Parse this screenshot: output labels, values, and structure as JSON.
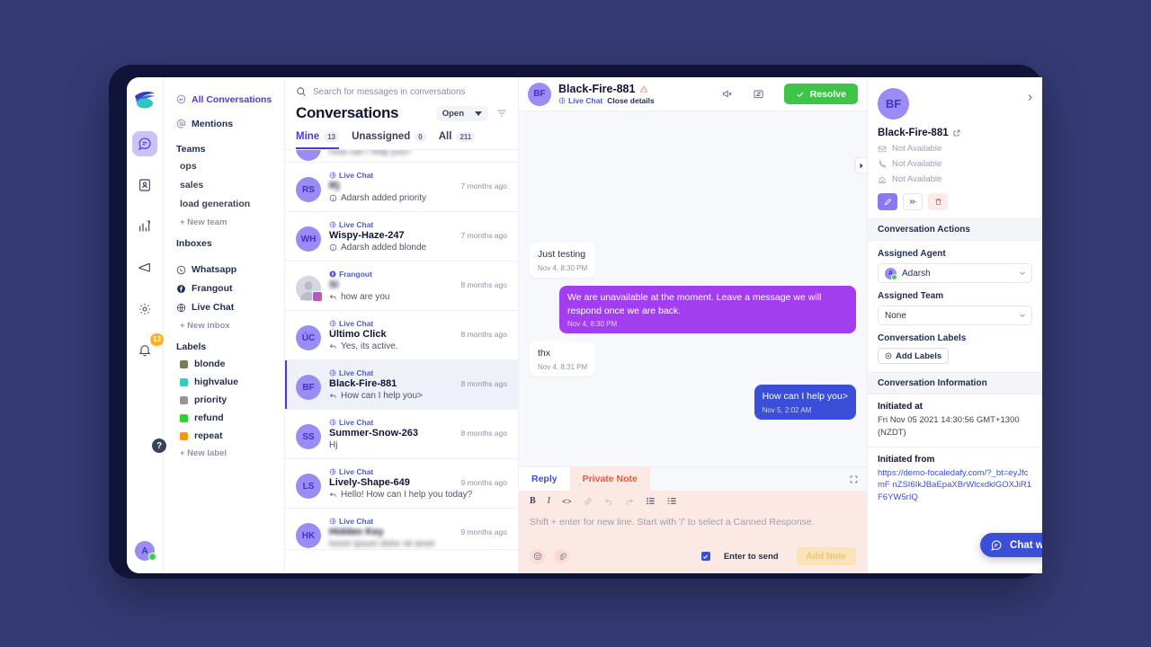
{
  "app": {
    "brand": "logo-icon"
  },
  "rail": {
    "items": [
      {
        "name": "conversations",
        "icon": "chat-bubble-icon",
        "active": true,
        "badge": ""
      },
      {
        "name": "contacts",
        "icon": "contact-card-icon",
        "active": false,
        "badge": ""
      },
      {
        "name": "reports",
        "icon": "bar-chart-icon",
        "active": false,
        "badge": ""
      },
      {
        "name": "campaigns",
        "icon": "megaphone-icon",
        "active": false,
        "badge": ""
      },
      {
        "name": "settings",
        "icon": "gear-icon",
        "active": false,
        "badge": ""
      },
      {
        "name": "notifications",
        "icon": "bell-icon",
        "active": false,
        "badge": "13"
      }
    ],
    "help_label": "?",
    "avatar_initial": "A"
  },
  "sidebar": {
    "top_links": [
      {
        "label": "All Conversations",
        "icon": "inbox-circle-icon",
        "selected": true
      },
      {
        "label": "Mentions",
        "icon": "at-sign-icon",
        "selected": false
      }
    ],
    "teams_heading": "Teams",
    "teams": [
      "ops",
      "sales",
      "load generation"
    ],
    "new_team_label": "+ New team",
    "inboxes_heading": "Inboxes",
    "inboxes": [
      {
        "label": "Whatsapp",
        "icon": "whatsapp-icon"
      },
      {
        "label": "Frangout",
        "icon": "facebook-icon"
      },
      {
        "label": "Live Chat",
        "icon": "globe-icon"
      }
    ],
    "new_inbox_label": "+ New inbox",
    "labels_heading": "Labels",
    "labels": [
      {
        "label": "blonde",
        "color": "#7c7a52"
      },
      {
        "label": "highvalue",
        "color": "#2ecfc0"
      },
      {
        "label": "priority",
        "color": "#9f9199"
      },
      {
        "label": "refund",
        "color": "#29d329"
      },
      {
        "label": "repeat",
        "color": "#f49a0b"
      }
    ],
    "new_label_label": "+ New label"
  },
  "conversations": {
    "search_placeholder": "Search for messages in conversations",
    "search_value": "",
    "title": "Conversations",
    "status_filter": "Open",
    "filter_icon": "filter-icon",
    "tabs": [
      {
        "label": "Mine",
        "count": "13",
        "active": true
      },
      {
        "label": "Unassigned",
        "count": "0",
        "active": false
      },
      {
        "label": "All",
        "count": "211",
        "active": false
      }
    ],
    "items": [
      {
        "initials": "",
        "avatar_type": "initials",
        "channel": "",
        "name": "",
        "preview": "How can I help you>",
        "time": "",
        "selected": false,
        "partial_top": true,
        "name_blurred": false,
        "preview_blurred": true
      },
      {
        "initials": "RS",
        "avatar_type": "initials",
        "channel": "Live Chat",
        "name": "R)",
        "preview": "Adarsh added priority",
        "time": "7 months ago",
        "selected": false,
        "name_blurred": true,
        "preview_icon": "info-icon"
      },
      {
        "initials": "WH",
        "avatar_type": "initials",
        "channel": "Live Chat",
        "name": "Wispy-Haze-247",
        "preview": "Adarsh added blonde",
        "time": "7 months ago",
        "selected": false,
        "preview_icon": "info-icon"
      },
      {
        "initials": "",
        "avatar_type": "photo",
        "channel": "Frangout",
        "name": "Si",
        "preview": "how are you",
        "time": "8 months ago",
        "selected": false,
        "name_blurred": true,
        "preview_icon": "reply-icon"
      },
      {
        "initials": "ÚC",
        "avatar_type": "initials",
        "channel": "Live Chat",
        "name": "Último Click",
        "preview": "Yes, its active.",
        "time": "8 months ago",
        "selected": false,
        "preview_icon": "reply-icon"
      },
      {
        "initials": "BF",
        "avatar_type": "initials",
        "channel": "Live Chat",
        "name": "Black-Fire-881",
        "preview": "How can I help you>",
        "time": "8 months ago",
        "selected": true,
        "preview_icon": "reply-icon"
      },
      {
        "initials": "SS",
        "avatar_type": "initials",
        "channel": "Live Chat",
        "name": "Summer-Snow-263",
        "preview": "Hj",
        "time": "8 months ago",
        "selected": false,
        "preview_icon": ""
      },
      {
        "initials": "LS",
        "avatar_type": "initials",
        "channel": "Live Chat",
        "name": "Lively-Shape-649",
        "preview": "Hello! How can I help you today?",
        "time": "9 months ago",
        "selected": false,
        "preview_icon": "reply-icon"
      },
      {
        "initials": "HK",
        "avatar_type": "initials",
        "channel": "Live Chat",
        "name": "",
        "preview": "",
        "time": "9 months ago",
        "selected": false,
        "name_blurred": true,
        "preview_blurred": true
      }
    ]
  },
  "chat": {
    "header": {
      "initials": "BF",
      "name": "Black-Fire-881",
      "warn_icon": "warning-triangle-icon",
      "channel": "Live Chat",
      "close_details_label": "Close details",
      "action_icons": [
        "mute-icon",
        "snooze-icon"
      ],
      "resolve_label": "Resolve"
    },
    "messages": [
      {
        "text": "Just testing",
        "time": "Nov 4, 8:30 PM",
        "side": "in",
        "color": "#ffffff"
      },
      {
        "text": "We are unavailable at the moment. Leave a message we will respond once we are back.",
        "time": "Nov 4, 8:30 PM",
        "side": "out",
        "color": "#a23ef0"
      },
      {
        "text": "thx",
        "time": "Nov 4, 8:31 PM",
        "side": "in",
        "color": "#ffffff"
      },
      {
        "text": "How can I help you>",
        "time": "Nov 5, 2:02 AM",
        "side": "out",
        "color": "#3b4ed8"
      }
    ],
    "composer": {
      "tabs": [
        {
          "label": "Reply",
          "active": true
        },
        {
          "label": "Private Note",
          "active": false
        }
      ],
      "expand_icon": "expand-icon",
      "tools": [
        "bold-icon",
        "italic-icon",
        "code-icon",
        "link-icon",
        "undo-icon",
        "redo-icon",
        "list-bullet-icon",
        "list-ordered-icon"
      ],
      "placeholder": "Shift + enter for new line. Start with '/' to select a Canned Response.",
      "emoji_icon": "emoji-icon",
      "attach_icon": "paperclip-icon",
      "enter_to_send_label": "Enter to send",
      "enter_to_send_checked": true,
      "send_label": "Add Note"
    }
  },
  "right_panel": {
    "initials": "BF",
    "name": "Black-Fire-881",
    "external_link_icon": "external-link-icon",
    "collapse_icon": "chevron-right-icon",
    "attributes": [
      {
        "icon": "email-icon",
        "value": "Not Available"
      },
      {
        "icon": "phone-icon",
        "value": "Not Available"
      },
      {
        "icon": "company-icon",
        "value": "Not Available"
      }
    ],
    "actions": [
      {
        "icon": "edit-pencil-icon",
        "style": "primary"
      },
      {
        "icon": "merge-icon",
        "style": "grey"
      },
      {
        "icon": "trash-icon",
        "style": "red"
      }
    ],
    "conversation_actions_heading": "Conversation Actions",
    "assigned_agent_label": "Assigned Agent",
    "assigned_agent_value": "Adarsh",
    "assigned_agent_initial": "A",
    "assigned_team_label": "Assigned Team",
    "assigned_team_value": "None",
    "conversation_labels_label": "Conversation Labels",
    "add_labels_label": "Add Labels",
    "conversation_information_heading": "Conversation Information",
    "initiated_at_label": "Initiated at",
    "initiated_at_value": "Fri Nov 05 2021 14:30:56 GMT+1300 (NZDT)",
    "initiated_from_label": "Initiated from",
    "initiated_from_value": "https://demo-focaledafy.com/?_bt=eyJfcmF nZSI6IkJBaEpaXBrWlcxdklGOXJiR1F6YW5rIQ"
  },
  "widget": {
    "chat_label": "Chat with u",
    "icon": "chat-widget-icon"
  }
}
